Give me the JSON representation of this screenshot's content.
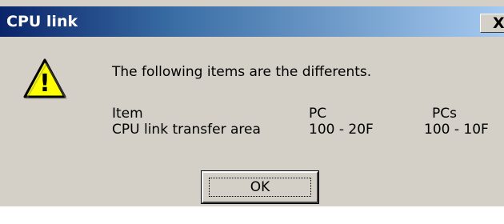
{
  "window": {
    "title": "CPU link",
    "close_symbol": "X"
  },
  "icon": {
    "name": "warning-icon",
    "symbol": "!"
  },
  "message": "The following items are the differents.",
  "table": {
    "headers": [
      "Item",
      "PC",
      "PCs"
    ],
    "rows": [
      [
        "CPU link transfer area",
        "100 - 20F",
        "100 - 10F"
      ]
    ]
  },
  "buttons": {
    "ok_label": "OK"
  },
  "colors": {
    "dialog_background": "#d4d0c8",
    "titlebar_start": "#0a246a",
    "titlebar_end": "#a6caf0",
    "warning_fill": "#ffff00"
  }
}
